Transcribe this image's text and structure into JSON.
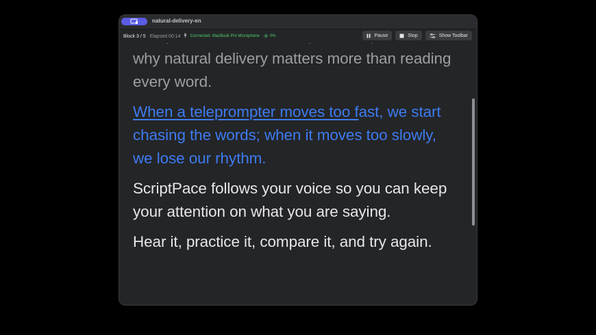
{
  "window": {
    "title": "natural-delivery-en"
  },
  "status": {
    "block": "Block 3 / 5",
    "elapsed": "Elapsed 00:14",
    "connected": "Connected: MacBook Pro Microphone",
    "level": "0%"
  },
  "toolbar": {
    "pause_label": "Pause",
    "stop_label": "Stop",
    "show_toolbar_label": "Show Toolbar"
  },
  "script": {
    "p1": "Today, I want to use a simple example to show why natural delivery matters more than reading every word.",
    "p2_read": "When a teleprompter moves too f",
    "p2_rest": "ast, we start chasing the words; when it moves too slowly, we lose our rhythm.",
    "p3": "ScriptPace follows your voice so you can keep your attention on what you are saying.",
    "p4": "Hear it, practice it, compare it, and try again."
  },
  "colors": {
    "accent": "#5a5ce6",
    "active_text": "#3d7bf0",
    "connected": "#4fcf6c",
    "background": "#242527"
  },
  "icons": [
    "screen-icon",
    "microphone-icon",
    "audio-level-icon",
    "pause-icon",
    "stop-icon",
    "sliders-icon"
  ]
}
